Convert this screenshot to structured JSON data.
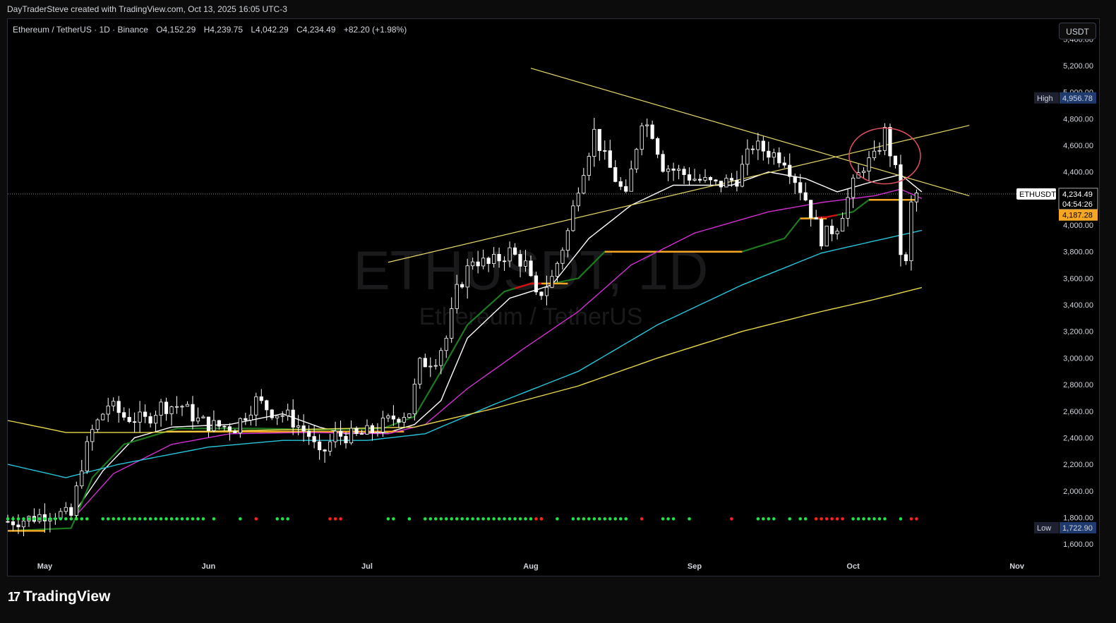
{
  "header": {
    "attribution": "DayTraderSteve created with TradingView.com, Oct 13, 2025 16:05 UTC-3"
  },
  "symbol_info": {
    "name": "Ethereum / TetherUS · 1D · Binance",
    "open": "O4,152.29",
    "high": "H4,239.75",
    "low": "L4,042.29",
    "close": "C4,234.49",
    "change": "+82.20 (+1.98%)"
  },
  "currency_button": "USDT",
  "watermark": {
    "title": "ETHUSDT, 1D",
    "subtitle": "Ethereum / TetherUS"
  },
  "footer": {
    "brand": "TradingView",
    "logo_icon": "tradingview-logo-icon"
  },
  "colors": {
    "background": "#000000",
    "candle": "#ffffff",
    "ma_white": "#ffffff",
    "ma_green": "#1e7a1e",
    "ma_magenta": "#d12fd1",
    "ma_cyan": "#25c6da",
    "ma_yellow": "#e8d84a",
    "trendline": "#e6d86a",
    "level_orange": "#f5a623",
    "dot_green": "#22e34a",
    "dot_red": "#ff2020",
    "circle": "#e05060"
  },
  "chart_data": {
    "type": "candlestick",
    "title": "Ethereum / TetherUS · 1D · Binance",
    "ylim": [
      1500,
      5550
    ],
    "y_ticks": [
      1600,
      1800,
      2000,
      2200,
      2400,
      2600,
      2800,
      3000,
      3200,
      3400,
      3600,
      3800,
      4000,
      4200,
      4400,
      4600,
      4800,
      5000,
      5200,
      5400
    ],
    "y_tick_labels": [
      "1,600.00",
      "1,800.00",
      "2,000.00",
      "2,200.00",
      "2,400.00",
      "2,600.00",
      "2,800.00",
      "3,000.00",
      "3,200.00",
      "3,400.00",
      "3,600.00",
      "3,800.00",
      "4,000.00",
      "4,200.00",
      "4,400.00",
      "4,600.00",
      "4,800.00",
      "5,000.00",
      "5,200.00",
      "5,400.00"
    ],
    "x_range": [
      "2025-04-24",
      "2025-11-08"
    ],
    "x_ticks": [
      {
        "date": "2025-05-01",
        "label": "May"
      },
      {
        "date": "2025-06-01",
        "label": "Jun"
      },
      {
        "date": "2025-07-01",
        "label": "Jul"
      },
      {
        "date": "2025-08-01",
        "label": "Aug"
      },
      {
        "date": "2025-09-01",
        "label": "Sep"
      },
      {
        "date": "2025-10-01",
        "label": "Oct"
      },
      {
        "date": "2025-11-01",
        "label": "Nov"
      }
    ],
    "price_tags": [
      {
        "label": "High",
        "value": 4956.78,
        "text": "4,956.78",
        "style": "high"
      },
      {
        "label": "ETHUSDT",
        "value": 4234.49,
        "text": "4,234.49",
        "sub": "04:54:26",
        "style": "last"
      },
      {
        "label": "",
        "value": 4187.28,
        "text": "4,187.28",
        "style": "orange"
      },
      {
        "label": "Low",
        "value": 1722.9,
        "text": "1,722.90",
        "style": "low"
      }
    ],
    "last_price": 4234.49,
    "close_points": [
      [
        "2025-04-24",
        1770
      ],
      [
        "2025-04-28",
        1790
      ],
      [
        "2025-05-02",
        1840
      ],
      [
        "2025-05-06",
        1810
      ],
      [
        "2025-05-08",
        2200
      ],
      [
        "2025-05-10",
        2450
      ],
      [
        "2025-05-13",
        2650
      ],
      [
        "2025-05-16",
        2560
      ],
      [
        "2025-05-20",
        2530
      ],
      [
        "2025-05-23",
        2640
      ],
      [
        "2025-05-27",
        2640
      ],
      [
        "2025-05-30",
        2530
      ],
      [
        "2025-06-02",
        2490
      ],
      [
        "2025-06-06",
        2480
      ],
      [
        "2025-06-10",
        2680
      ],
      [
        "2025-06-13",
        2600
      ],
      [
        "2025-06-16",
        2560
      ],
      [
        "2025-06-20",
        2420
      ],
      [
        "2025-06-22",
        2250
      ],
      [
        "2025-06-25",
        2420
      ],
      [
        "2025-06-29",
        2410
      ],
      [
        "2025-07-02",
        2450
      ],
      [
        "2025-07-06",
        2550
      ],
      [
        "2025-07-09",
        2600
      ],
      [
        "2025-07-11",
        2950
      ],
      [
        "2025-07-14",
        3000
      ],
      [
        "2025-07-16",
        3150
      ],
      [
        "2025-07-18",
        3500
      ],
      [
        "2025-07-21",
        3750
      ],
      [
        "2025-07-24",
        3700
      ],
      [
        "2025-07-28",
        3800
      ],
      [
        "2025-07-31",
        3700
      ],
      [
        "2025-08-02",
        3450
      ],
      [
        "2025-08-05",
        3600
      ],
      [
        "2025-08-08",
        3950
      ],
      [
        "2025-08-10",
        4300
      ],
      [
        "2025-08-13",
        4700
      ],
      [
        "2025-08-15",
        4500
      ],
      [
        "2025-08-19",
        4200
      ],
      [
        "2025-08-22",
        4800
      ],
      [
        "2025-08-24",
        4700
      ],
      [
        "2025-08-26",
        4450
      ],
      [
        "2025-08-29",
        4400
      ],
      [
        "2025-09-01",
        4350
      ],
      [
        "2025-09-05",
        4300
      ],
      [
        "2025-09-09",
        4350
      ],
      [
        "2025-09-12",
        4600
      ],
      [
        "2025-09-15",
        4550
      ],
      [
        "2025-09-18",
        4500
      ],
      [
        "2025-09-22",
        4200
      ],
      [
        "2025-09-25",
        3900
      ],
      [
        "2025-09-28",
        4000
      ],
      [
        "2025-10-01",
        4300
      ],
      [
        "2025-10-03",
        4450
      ],
      [
        "2025-10-05",
        4500
      ],
      [
        "2025-10-07",
        4700
      ],
      [
        "2025-10-09",
        4400
      ],
      [
        "2025-10-10",
        3800
      ],
      [
        "2025-10-11",
        3700
      ],
      [
        "2025-10-12",
        4150
      ],
      [
        "2025-10-13",
        4234
      ]
    ],
    "series": [
      {
        "key": "ma_white",
        "points": [
          [
            "2025-05-07",
            1860
          ],
          [
            "2025-05-12",
            2150
          ],
          [
            "2025-05-18",
            2400
          ],
          [
            "2025-05-25",
            2480
          ],
          [
            "2025-06-05",
            2500
          ],
          [
            "2025-06-15",
            2580
          ],
          [
            "2025-06-22",
            2480
          ],
          [
            "2025-06-27",
            2430
          ],
          [
            "2025-07-05",
            2440
          ],
          [
            "2025-07-10",
            2500
          ],
          [
            "2025-07-15",
            2680
          ],
          [
            "2025-07-20",
            3150
          ],
          [
            "2025-07-28",
            3450
          ],
          [
            "2025-08-05",
            3550
          ],
          [
            "2025-08-12",
            3900
          ],
          [
            "2025-08-20",
            4150
          ],
          [
            "2025-08-28",
            4300
          ],
          [
            "2025-09-08",
            4300
          ],
          [
            "2025-09-15",
            4400
          ],
          [
            "2025-09-22",
            4350
          ],
          [
            "2025-09-28",
            4250
          ],
          [
            "2025-10-05",
            4330
          ],
          [
            "2025-10-10",
            4380
          ],
          [
            "2025-10-14",
            4250
          ]
        ]
      },
      {
        "key": "ma_green",
        "points": [
          [
            "2025-04-24",
            1700
          ],
          [
            "2025-05-06",
            1720
          ],
          [
            "2025-05-10",
            2100
          ],
          [
            "2025-05-16",
            2350
          ],
          [
            "2025-05-26",
            2470
          ],
          [
            "2025-06-10",
            2470
          ],
          [
            "2025-06-22",
            2460
          ],
          [
            "2025-07-04",
            2470
          ],
          [
            "2025-07-10",
            2560
          ],
          [
            "2025-07-15",
            2900
          ],
          [
            "2025-07-20",
            3250
          ],
          [
            "2025-07-27",
            3500
          ],
          [
            "2025-08-01",
            3560
          ],
          [
            "2025-08-05",
            3560
          ],
          [
            "2025-08-10",
            3600
          ],
          [
            "2025-08-15",
            3800
          ],
          [
            "2025-09-10",
            3800
          ],
          [
            "2025-09-18",
            3900
          ],
          [
            "2025-09-21",
            4050
          ],
          [
            "2025-09-26",
            4060
          ],
          [
            "2025-10-01",
            4100
          ],
          [
            "2025-10-04",
            4190
          ],
          [
            "2025-10-09",
            4190
          ]
        ],
        "red_segments": [
          [
            "2025-07-29",
            "2025-08-03"
          ],
          [
            "2025-09-24",
            "2025-09-28"
          ]
        ],
        "orange_segments": [
          [
            "2025-08-01",
            "2025-08-08"
          ],
          [
            "2025-08-15",
            "2025-09-10"
          ],
          [
            "2025-09-21",
            "2025-09-26"
          ],
          [
            "2025-10-04",
            "2025-10-13"
          ],
          [
            "2025-05-24",
            "2025-07-08"
          ],
          [
            "2025-04-24",
            "2025-05-01"
          ]
        ]
      },
      {
        "key": "ma_magenta",
        "points": [
          [
            "2025-05-07",
            1820
          ],
          [
            "2025-05-14",
            2130
          ],
          [
            "2025-05-25",
            2350
          ],
          [
            "2025-06-05",
            2430
          ],
          [
            "2025-06-20",
            2440
          ],
          [
            "2025-07-05",
            2430
          ],
          [
            "2025-07-12",
            2500
          ],
          [
            "2025-07-20",
            2770
          ],
          [
            "2025-07-31",
            3080
          ],
          [
            "2025-08-10",
            3350
          ],
          [
            "2025-08-20",
            3700
          ],
          [
            "2025-09-01",
            3940
          ],
          [
            "2025-09-15",
            4100
          ],
          [
            "2025-09-25",
            4170
          ],
          [
            "2025-10-05",
            4220
          ],
          [
            "2025-10-10",
            4270
          ],
          [
            "2025-10-14",
            4200
          ]
        ]
      },
      {
        "key": "ma_cyan",
        "points": [
          [
            "2025-04-24",
            2200
          ],
          [
            "2025-05-05",
            2100
          ],
          [
            "2025-05-15",
            2200
          ],
          [
            "2025-06-01",
            2330
          ],
          [
            "2025-06-15",
            2380
          ],
          [
            "2025-07-01",
            2380
          ],
          [
            "2025-07-12",
            2430
          ],
          [
            "2025-07-25",
            2650
          ],
          [
            "2025-08-10",
            2900
          ],
          [
            "2025-08-25",
            3250
          ],
          [
            "2025-09-10",
            3550
          ],
          [
            "2025-09-25",
            3790
          ],
          [
            "2025-10-05",
            3880
          ],
          [
            "2025-10-14",
            3960
          ]
        ]
      },
      {
        "key": "ma_yellow",
        "points": [
          [
            "2025-04-24",
            2530
          ],
          [
            "2025-05-05",
            2440
          ],
          [
            "2025-05-20",
            2440
          ],
          [
            "2025-06-15",
            2460
          ],
          [
            "2025-07-10",
            2480
          ],
          [
            "2025-07-25",
            2620
          ],
          [
            "2025-08-10",
            2790
          ],
          [
            "2025-08-25",
            3000
          ],
          [
            "2025-09-10",
            3200
          ],
          [
            "2025-09-25",
            3350
          ],
          [
            "2025-10-05",
            3440
          ],
          [
            "2025-10-14",
            3530
          ]
        ]
      }
    ],
    "trendlines": [
      {
        "from": [
          "2025-08-01",
          5180
        ],
        "to": [
          "2025-10-23",
          4220
        ]
      },
      {
        "from": [
          "2025-07-05",
          3720
        ],
        "to": [
          "2025-10-23",
          4750
        ]
      }
    ],
    "highlight_circle": {
      "center": [
        "2025-10-07",
        4520
      ],
      "rx_days": 5,
      "ry_value": 210
    },
    "signal_dots": {
      "y_value": 1790,
      "green_runs": [
        [
          "2025-04-24",
          "2025-05-09"
        ],
        [
          "2025-05-12",
          "2025-05-31"
        ],
        [
          "2025-06-02",
          "2025-06-02"
        ],
        [
          "2025-06-07",
          "2025-06-07"
        ],
        [
          "2025-06-14",
          "2025-06-16"
        ],
        [
          "2025-07-05",
          "2025-07-06"
        ],
        [
          "2025-07-09",
          "2025-07-09"
        ],
        [
          "2025-07-12",
          "2025-08-01"
        ],
        [
          "2025-08-03",
          "2025-08-03"
        ],
        [
          "2025-08-06",
          "2025-08-06"
        ],
        [
          "2025-08-09",
          "2025-08-19"
        ],
        [
          "2025-08-26",
          "2025-08-28"
        ],
        [
          "2025-08-31",
          "2025-08-31"
        ],
        [
          "2025-09-13",
          "2025-09-16"
        ],
        [
          "2025-09-19",
          "2025-09-19"
        ],
        [
          "2025-09-21",
          "2025-09-22"
        ],
        [
          "2025-10-01",
          "2025-10-07"
        ],
        [
          "2025-10-10",
          "2025-10-10"
        ]
      ],
      "red_runs": [
        [
          "2025-06-10",
          "2025-06-10"
        ],
        [
          "2025-06-24",
          "2025-06-26"
        ],
        [
          "2025-08-02",
          "2025-08-03"
        ],
        [
          "2025-08-22",
          "2025-08-22"
        ],
        [
          "2025-09-08",
          "2025-09-08"
        ],
        [
          "2025-09-24",
          "2025-09-29"
        ],
        [
          "2025-10-12",
          "2025-10-13"
        ]
      ]
    }
  }
}
